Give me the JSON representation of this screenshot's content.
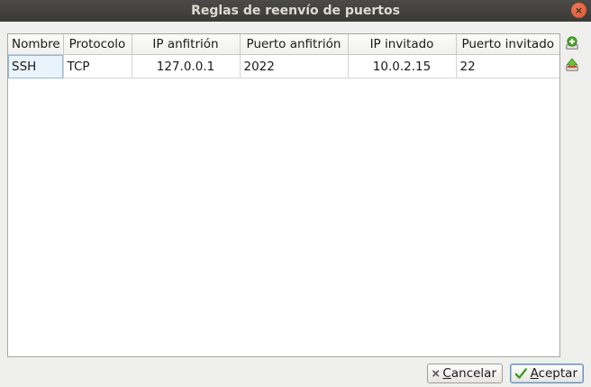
{
  "window": {
    "title": "Reglas de reenvío de puertos",
    "close_glyph": "×"
  },
  "table": {
    "columns": [
      "Nombre",
      "Protocolo",
      "IP anfitrión",
      "Puerto anfitrión",
      "IP invitado",
      "Puerto invitado"
    ],
    "rows": [
      [
        "SSH",
        "TCP",
        "127.0.0.1",
        "2022",
        "10.0.2.15",
        "22"
      ]
    ]
  },
  "side_actions": {
    "add_icon": "add-rule-icon",
    "remove_icon": "remove-rule-icon"
  },
  "buttons": {
    "cancel_mnemonic": "C",
    "cancel_rest": "ancelar",
    "accept_mnemonic": "A",
    "accept_rest": "ceptar"
  },
  "colors": {
    "titlebar": "#3b3a36",
    "close": "#e0612f",
    "add_green": "#4ea82a",
    "remove_red": "#d64a2a"
  }
}
